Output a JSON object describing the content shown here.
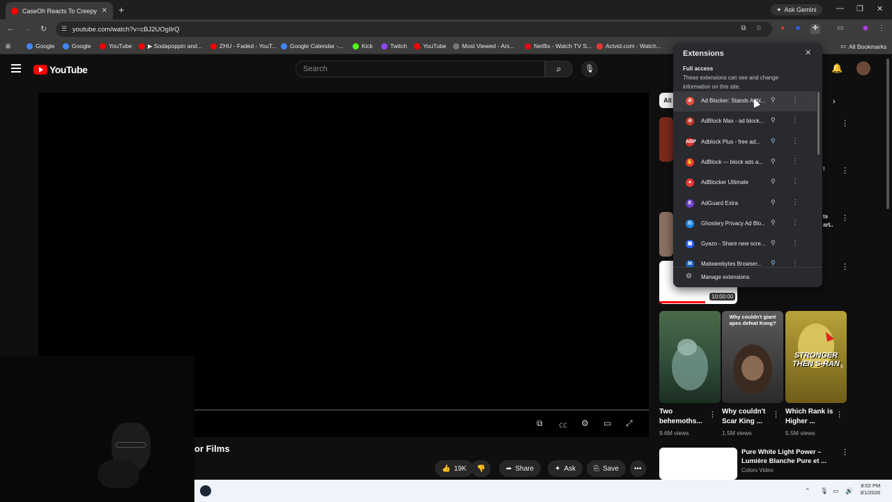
{
  "browser": {
    "tab_title": "CaseOh Reacts To Creepy Short",
    "new_tab": "+",
    "gemini_label": "Ask Gemini",
    "url": "youtube.com/watch?v=cBJ2UOgIlrQ",
    "all_bookmarks": "All Bookmarks",
    "bookmarks": [
      {
        "label": "Google",
        "color": "#4285f4"
      },
      {
        "label": "Google",
        "color": "#4285f4"
      },
      {
        "label": "YouTube",
        "color": "#ff0000"
      },
      {
        "label": "▶ Sodapoppin and...",
        "color": "#ff0000"
      },
      {
        "label": "ZHU - Faded - YouT...",
        "color": "#ff0000"
      },
      {
        "label": "Google Calendar -...",
        "color": "#4285f4"
      },
      {
        "label": "Kick",
        "color": "#53fc18"
      },
      {
        "label": "Twitch",
        "color": "#9146ff"
      },
      {
        "label": "YouTube",
        "color": "#ff0000"
      },
      {
        "label": "Most Viewed - Ani...",
        "color": "#777777"
      },
      {
        "label": "Netflix - Watch TV S...",
        "color": "#e50914"
      },
      {
        "label": "Actvid.com - Watch...",
        "color": "#e53935"
      }
    ]
  },
  "youtube": {
    "logo_text": "YouTube",
    "search_placeholder": "Search",
    "video_title_fragment": "or Films",
    "actions": {
      "like_count": "19K",
      "share": "Share",
      "ask": "Ask",
      "save": "Save"
    },
    "chip_all": "All",
    "duration": "10:00:00",
    "shorts": [
      {
        "title": "Two behemoths...",
        "views": "9.6M views"
      },
      {
        "title": "Why couldn't Scar King ...",
        "views": "1.5M views"
      },
      {
        "title": "Which Rank is Higher ...",
        "views": "5.5M views"
      }
    ],
    "thumb_caption_kong": "Why couldn't giant apes defeat Kong?",
    "thumb_caption_stronger": "STRONGER THEN S-RAN",
    "rec": {
      "title": "Pure White Light Power – Lumière Blanche Pure et ...",
      "channel": "Colors Video"
    },
    "side_fragments": [
      "ts",
      "art..",
      "!"
    ]
  },
  "extensions": {
    "title": "Extensions",
    "full_access_heading": "Full access",
    "full_access_desc": "These extensions can see and change information on this site.",
    "items": [
      {
        "name": "Ad Blocker: Stands Adbl...",
        "color": "#e74c3c",
        "glyph": "⊘",
        "pinned": false
      },
      {
        "name": "AdBlock Max - ad block...",
        "color": "#c0392b",
        "glyph": "⊘",
        "pinned": false
      },
      {
        "name": "Adblock Plus - free ad...",
        "color": "#d32f2f",
        "glyph": "ABP",
        "pinned": true
      },
      {
        "name": "AdBlock — block ads a...",
        "color": "#e53935",
        "glyph": "✋",
        "pinned": false
      },
      {
        "name": "AdBlocker Ultimate",
        "color": "#e53935",
        "glyph": "●",
        "pinned": false
      },
      {
        "name": "AdGuard Extra",
        "color": "#6a3fc5",
        "glyph": "E",
        "pinned": false
      },
      {
        "name": "Ghostery Privacy Ad Blo...",
        "color": "#1e88e5",
        "glyph": "G",
        "pinned": false
      },
      {
        "name": "Gyazo - Share new scre...",
        "color": "#2962ff",
        "glyph": "▣",
        "pinned": false
      },
      {
        "name": "Malwarebytes Browser...",
        "color": "#1565c0",
        "glyph": "M",
        "pinned": true
      }
    ],
    "manage_label": "Manage extensions"
  },
  "taskbar": {
    "time": "8:02 PM",
    "date": "3/1/2026"
  }
}
